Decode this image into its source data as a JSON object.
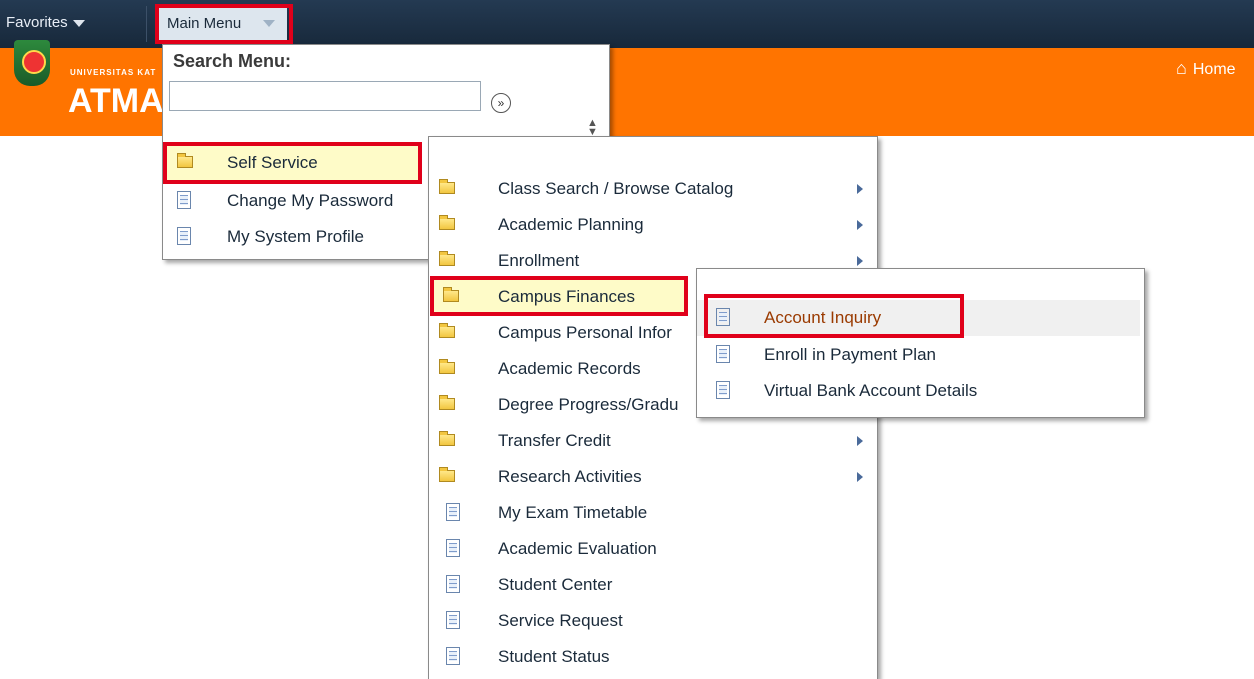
{
  "topbar": {
    "favorites_label": "Favorites",
    "main_menu_label": "Main Menu"
  },
  "banner": {
    "logo_small_text": "UNIVERSITAS KAT",
    "logo_big_text": "ATMA",
    "home_label": "Home",
    "home_icon": "house-icon",
    "background_color": "#ff7400"
  },
  "main_menu": {
    "search_title": "Search Menu:",
    "search_placeholder": "",
    "search_go_icon": "double-chevron-right-icon",
    "go_glyph": "»",
    "scroll_glyph_up": "▲",
    "scroll_glyph_down": "▼",
    "items": [
      {
        "label": "Self Service",
        "icon": "folder-icon",
        "selected": true
      },
      {
        "label": "Change My Password",
        "icon": "document-icon"
      },
      {
        "label": "My System Profile",
        "icon": "document-icon"
      }
    ]
  },
  "self_service_menu": {
    "items": [
      {
        "label": "Class Search / Browse Catalog",
        "icon": "folder-icon",
        "has_submenu": true
      },
      {
        "label": "Academic Planning",
        "icon": "folder-icon",
        "has_submenu": true
      },
      {
        "label": "Enrollment",
        "icon": "folder-icon",
        "has_submenu": true
      },
      {
        "label": "Campus Finances",
        "icon": "folder-icon",
        "selected": true
      },
      {
        "label": "Campus Personal Infor",
        "icon": "folder-icon"
      },
      {
        "label": "Academic Records",
        "icon": "folder-icon"
      },
      {
        "label": "Degree Progress/Gradu",
        "icon": "folder-icon"
      },
      {
        "label": "Transfer Credit",
        "icon": "folder-icon",
        "has_submenu": true
      },
      {
        "label": "Research Activities",
        "icon": "folder-icon",
        "has_submenu": true
      },
      {
        "label": "My Exam Timetable",
        "icon": "document-icon"
      },
      {
        "label": "Academic Evaluation",
        "icon": "document-icon"
      },
      {
        "label": "Student Center",
        "icon": "document-icon"
      },
      {
        "label": "Service Request",
        "icon": "document-icon"
      },
      {
        "label": "Student Status",
        "icon": "document-icon"
      }
    ]
  },
  "campus_finances_menu": {
    "items": [
      {
        "label": "Account Inquiry",
        "icon": "document-icon",
        "hovered": true
      },
      {
        "label": "Enroll in Payment Plan",
        "icon": "document-icon"
      },
      {
        "label": "Virtual Bank Account Details",
        "icon": "document-icon"
      }
    ]
  },
  "colors": {
    "topbar": "#1e3248",
    "highlight_box": "#e0001a",
    "selected_row": "#fefbc8"
  }
}
